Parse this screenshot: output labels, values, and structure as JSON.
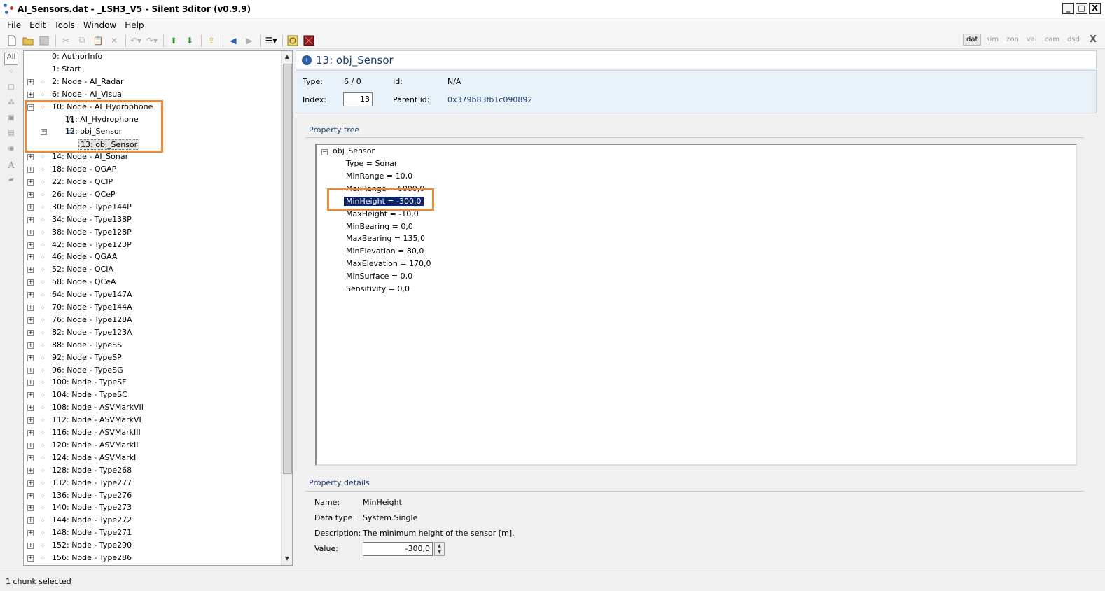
{
  "window": {
    "title": "AI_Sensors.dat - _LSH3_V5 - Silent 3ditor (v0.9.9)",
    "buttons": [
      "_",
      "□",
      "X"
    ]
  },
  "menu": [
    "File",
    "Edit",
    "Tools",
    "Window",
    "Help"
  ],
  "toolbar": {
    "mode_tabs": [
      "dat",
      "sim",
      "zon",
      "val",
      "cam",
      "dsd"
    ],
    "active_mode": "dat",
    "close_label": "X"
  },
  "filter": {
    "all_label": "All",
    "text_filter_label": "A"
  },
  "tree": {
    "items": [
      {
        "label": "0: AuthorInfo"
      },
      {
        "label": "1: Start"
      },
      {
        "label": "2: Node - AI_Radar"
      },
      {
        "label": "6: Node - AI_Visual"
      },
      {
        "label": "10: Node - AI_Hydrophone"
      },
      {
        "label": "11: AI_Hydrophone"
      },
      {
        "label": "12: obj_Sensor"
      },
      {
        "label": "13: obj_Sensor"
      },
      {
        "label": "14: Node - AI_Sonar"
      },
      {
        "label": "18: Node - QGAP"
      },
      {
        "label": "22: Node - QCIP"
      },
      {
        "label": "26: Node - QCeP"
      },
      {
        "label": "30: Node - Type144P"
      },
      {
        "label": "34: Node - Type138P"
      },
      {
        "label": "38: Node - Type128P"
      },
      {
        "label": "42: Node - Type123P"
      },
      {
        "label": "46: Node - QGAA"
      },
      {
        "label": "52: Node - QCIA"
      },
      {
        "label": "58: Node - QCeA"
      },
      {
        "label": "64: Node - Type147A"
      },
      {
        "label": "70: Node - Type144A"
      },
      {
        "label": "76: Node - Type128A"
      },
      {
        "label": "82: Node - Type123A"
      },
      {
        "label": "88: Node - TypeSS"
      },
      {
        "label": "92: Node - TypeSP"
      },
      {
        "label": "96: Node - TypeSG"
      },
      {
        "label": "100: Node - TypeSF"
      },
      {
        "label": "104: Node - TypeSC"
      },
      {
        "label": "108: Node - ASVMarkVII"
      },
      {
        "label": "112: Node - ASVMarkVI"
      },
      {
        "label": "116: Node - ASVMarkIII"
      },
      {
        "label": "120: Node - ASVMarkII"
      },
      {
        "label": "124: Node - ASVMarkI"
      },
      {
        "label": "128: Node - Type268"
      },
      {
        "label": "132: Node - Type277"
      },
      {
        "label": "136: Node - Type276"
      },
      {
        "label": "140: Node - Type273"
      },
      {
        "label": "144: Node - Type272"
      },
      {
        "label": "148: Node - Type271"
      },
      {
        "label": "152: Node - Type290"
      },
      {
        "label": "156: Node - Type286"
      }
    ]
  },
  "chunk": {
    "header_title": "13: obj_Sensor",
    "type_label": "Type:",
    "type_value": "6 / 0",
    "id_label": "Id:",
    "id_value": "N/A",
    "index_label": "Index:",
    "index_value": "13",
    "parent_label": "Parent id:",
    "parent_value": "0x379b83fb1c090892"
  },
  "property_tree": {
    "title": "Property tree",
    "root": "obj_Sensor",
    "items": [
      "Type = Sonar",
      "MinRange = 10,0",
      "MaxRange = 6000,0",
      "MinHeight = -300,0",
      "MaxHeight = -10,0",
      "MinBearing = 0,0",
      "MaxBearing = 135,0",
      "MinElevation = 80,0",
      "MaxElevation = 170,0",
      "MinSurface = 0,0",
      "Sensitivity = 0,0"
    ],
    "selected_index": 3
  },
  "property_details": {
    "title": "Property details",
    "name_label": "Name:",
    "name_value": "MinHeight",
    "datatype_label": "Data type:",
    "datatype_value": "System.Single",
    "description_label": "Description:",
    "description_value": "The minimum height of the sensor [m].",
    "value_label": "Value:",
    "value": "-300,0"
  },
  "status": {
    "text": "1 chunk selected"
  },
  "colors": {
    "highlight_box": "#e8883a",
    "selection_bg": "#0a246a",
    "section_title": "#1c3d6e",
    "info_panel_bg": "#e9f1f8"
  }
}
